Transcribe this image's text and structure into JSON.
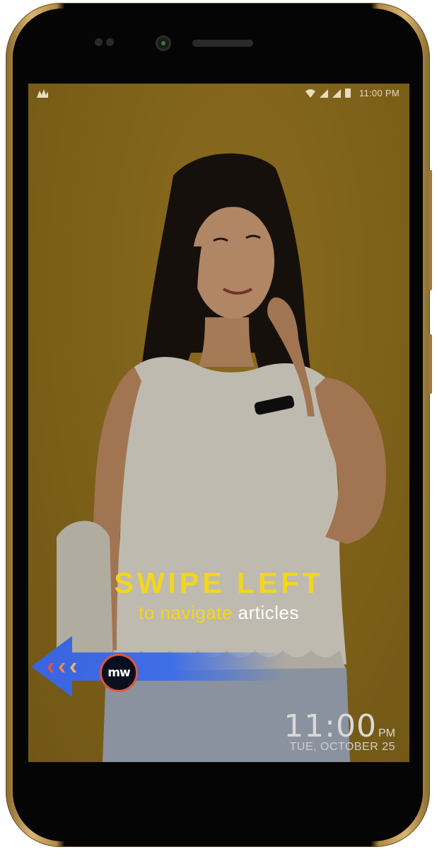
{
  "statusbar": {
    "time": "11:00 PM"
  },
  "overlay": {
    "title": "SWIPE LEFT",
    "subtitle_highlight": "to navigate",
    "subtitle_rest": " articles"
  },
  "swipe_hint": {
    "logo_text": "mw",
    "chevrons": [
      "‹",
      "‹",
      "‹"
    ]
  },
  "lockscreen": {
    "time": "11:00",
    "ampm": "PM",
    "date": "TUE, OCTOBER 25"
  },
  "colors": {
    "accent_yellow": "#f4d61a",
    "arrow_blue": "#3a63e0",
    "badge_ring": "#e0573b",
    "phone_gold": "#c9a35a"
  }
}
